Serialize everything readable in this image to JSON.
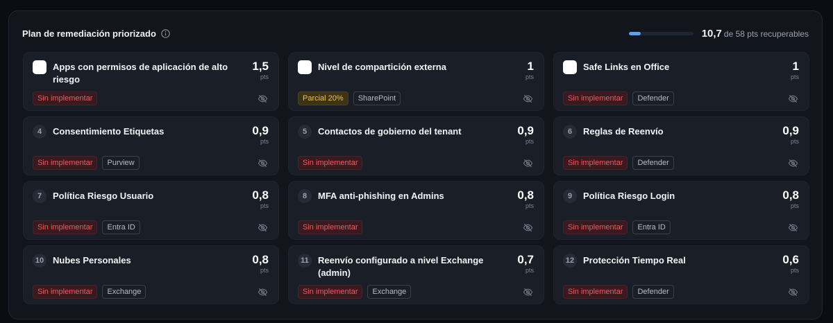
{
  "header": {
    "title": "Plan de remediación priorizado",
    "score_value": "10,7",
    "score_suffix": "de 58 pts recuperables",
    "progress_fraction": 0.184
  },
  "cards": [
    {
      "marker": "check",
      "number": "",
      "title": "Apps con permisos de aplicación de alto riesgo",
      "points": "1,5",
      "unit": "pts",
      "status": "Sin implementar",
      "status_kind": "none",
      "category": ""
    },
    {
      "marker": "check",
      "number": "",
      "title": "Nivel de compartición externa",
      "points": "1",
      "unit": "pts",
      "status": "Parcial 20%",
      "status_kind": "partial",
      "category": "SharePoint"
    },
    {
      "marker": "check",
      "number": "",
      "title": "Safe Links en Office",
      "points": "1",
      "unit": "pts",
      "status": "Sin implementar",
      "status_kind": "none",
      "category": "Defender"
    },
    {
      "marker": "num",
      "number": "4",
      "title": "Consentimiento Etiquetas",
      "points": "0,9",
      "unit": "pts",
      "status": "Sin implementar",
      "status_kind": "none",
      "category": "Purview"
    },
    {
      "marker": "num",
      "number": "5",
      "title": "Contactos de gobierno del tenant",
      "points": "0,9",
      "unit": "pts",
      "status": "Sin implementar",
      "status_kind": "none",
      "category": ""
    },
    {
      "marker": "num",
      "number": "6",
      "title": "Reglas de Reenvío",
      "points": "0,9",
      "unit": "pts",
      "status": "Sin implementar",
      "status_kind": "none",
      "category": "Defender"
    },
    {
      "marker": "num",
      "number": "7",
      "title": "Política Riesgo Usuario",
      "points": "0,8",
      "unit": "pts",
      "status": "Sin implementar",
      "status_kind": "none",
      "category": "Entra ID"
    },
    {
      "marker": "num",
      "number": "8",
      "title": "MFA anti-phishing en Admins",
      "points": "0,8",
      "unit": "pts",
      "status": "Sin implementar",
      "status_kind": "none",
      "category": ""
    },
    {
      "marker": "num",
      "number": "9",
      "title": "Política Riesgo Login",
      "points": "0,8",
      "unit": "pts",
      "status": "Sin implementar",
      "status_kind": "none",
      "category": "Entra ID"
    },
    {
      "marker": "num",
      "number": "10",
      "title": "Nubes Personales",
      "points": "0,8",
      "unit": "pts",
      "status": "Sin implementar",
      "status_kind": "none",
      "category": "Exchange"
    },
    {
      "marker": "num",
      "number": "11",
      "title": "Reenvío configurado a nivel Exchange (admin)",
      "points": "0,7",
      "unit": "pts",
      "status": "Sin implementar",
      "status_kind": "none",
      "category": "Exchange"
    },
    {
      "marker": "num",
      "number": "12",
      "title": "Protección Tiempo Real",
      "points": "0,6",
      "unit": "pts",
      "status": "Sin implementar",
      "status_kind": "none",
      "category": "Defender"
    }
  ],
  "icons": {
    "info": "info-icon",
    "hide": "eye-off-icon"
  },
  "colors": {
    "accent": "#5aa2ee",
    "danger": "#ef5a60",
    "warning": "#f1c24a"
  }
}
